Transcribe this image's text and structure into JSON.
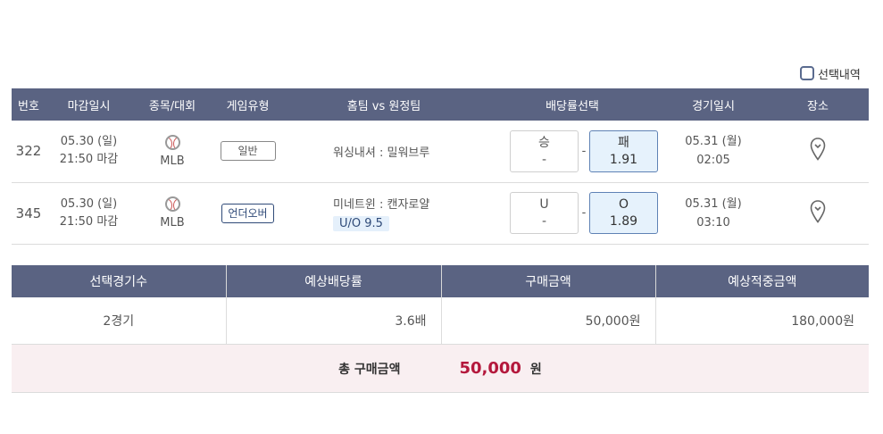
{
  "selection_history_label": "선택내역",
  "table_headers": [
    "번호",
    "마감일시",
    "종목/대회",
    "게임유형",
    "홈팀 vs 원정팀",
    "배당률선택",
    "경기일시",
    "장소"
  ],
  "games": [
    {
      "number": "322",
      "deadline_date": "05.30 (일)",
      "deadline_time": "21:50 마감",
      "league": "MLB",
      "game_type": "일반",
      "teams": "워싱내셔 : 밀워브루",
      "ou_line": "",
      "home_option_label": "승",
      "home_option_odds": "-",
      "draw_value": "-",
      "away_option_label": "패",
      "away_option_odds": "1.91",
      "match_date": "05.31 (월)",
      "match_time": "02:05"
    },
    {
      "number": "345",
      "deadline_date": "05.30 (일)",
      "deadline_time": "21:50 마감",
      "league": "MLB",
      "game_type": "언더오버",
      "teams": "미네트윈 : 캔자로얄",
      "ou_line": "U/O 9.5",
      "home_option_label": "U",
      "home_option_odds": "-",
      "draw_value": "-",
      "away_option_label": "O",
      "away_option_odds": "1.89",
      "match_date": "05.31 (월)",
      "match_time": "03:10"
    }
  ],
  "summary": {
    "headers": [
      "선택경기수",
      "예상배당률",
      "구매금액",
      "예상적중금액"
    ],
    "values": [
      "2경기",
      "3.6배",
      "50,000원",
      "180,000원"
    ]
  },
  "total": {
    "label": "총 구매금액",
    "amount": "50,000",
    "unit": "원"
  }
}
